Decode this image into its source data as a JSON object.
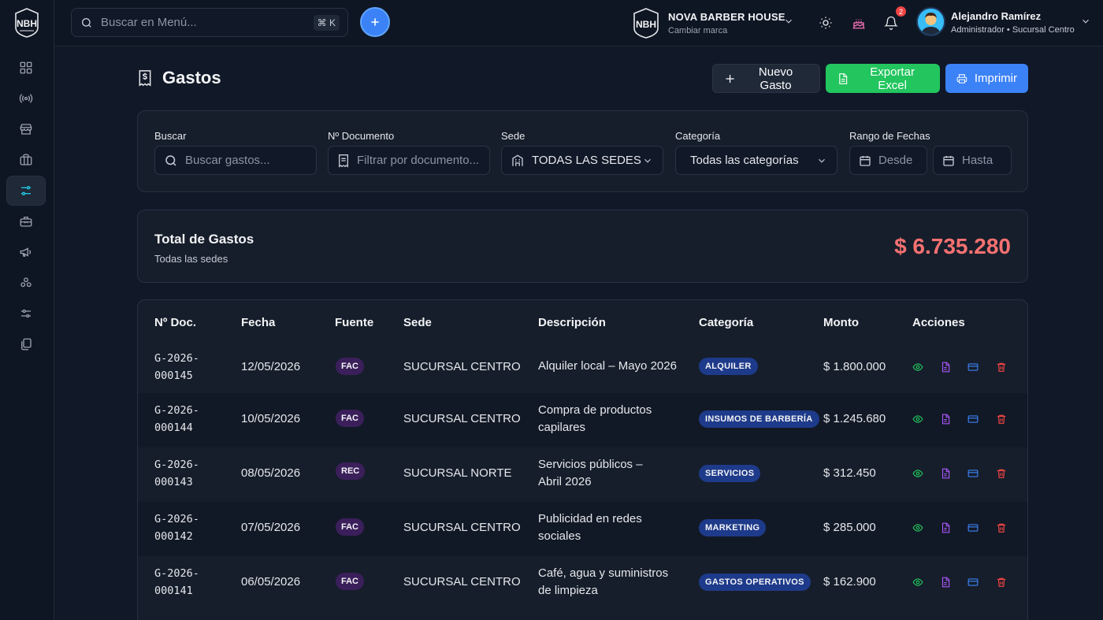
{
  "brand": {
    "logo_text": "NBH",
    "name": "NOVA BARBER HOUSE",
    "switch_label": "Cambiar marca"
  },
  "search_menu": {
    "placeholder": "Buscar en Menú...",
    "shortcut": "⌘ K"
  },
  "notifications": {
    "count": "2"
  },
  "user": {
    "name": "Alejandro Ramírez",
    "role": "Administrador • Sucursal Centro"
  },
  "sidebar": {
    "items": [
      {
        "icon": "dashboard-icon"
      },
      {
        "icon": "broadcast-icon"
      },
      {
        "icon": "store-icon"
      },
      {
        "icon": "briefcase-icon"
      },
      {
        "icon": "sliders-icon",
        "active": true
      },
      {
        "icon": "toolbox-icon"
      },
      {
        "icon": "megaphone-icon"
      },
      {
        "icon": "network-icon"
      },
      {
        "icon": "settings-sliders-icon"
      },
      {
        "icon": "documents-icon"
      }
    ]
  },
  "page": {
    "title": "Gastos",
    "buttons": {
      "new": "Nuevo Gasto",
      "export": "Exportar Excel",
      "print": "Imprimir"
    }
  },
  "filters": {
    "search": {
      "label": "Buscar",
      "placeholder": "Buscar gastos..."
    },
    "document": {
      "label": "Nº Documento",
      "placeholder": "Filtrar por documento..."
    },
    "sede": {
      "label": "Sede",
      "value": "TODAS LAS SEDES"
    },
    "category": {
      "label": "Categoría",
      "value": "Todas las categorías"
    },
    "date_range": {
      "label": "Rango de Fechas",
      "from": "Desde",
      "to": "Hasta"
    }
  },
  "total": {
    "label": "Total de Gastos",
    "sublabel": "Todas las sedes",
    "value": "$ 6.735.280"
  },
  "table": {
    "headers": {
      "doc": "Nº Doc.",
      "date": "Fecha",
      "source": "Fuente",
      "sede": "Sede",
      "desc": "Descripción",
      "category": "Categoría",
      "amount": "Monto",
      "actions": "Acciones"
    },
    "rows": [
      {
        "doc1": "G-2026-",
        "doc2": "000145",
        "date": "12/05/2026",
        "source": "FAC",
        "sede": "SUCURSAL CENTRO",
        "desc1": "Alquiler local – Mayo 2026",
        "desc2": "",
        "category": "ALQUILER",
        "amount": "$ 1.800.000"
      },
      {
        "doc1": "G-2026-",
        "doc2": "000144",
        "date": "10/05/2026",
        "source": "FAC",
        "sede": "SUCURSAL CENTRO",
        "desc1": "Compra de productos",
        "desc2": "capilares",
        "category": "INSUMOS DE BARBERÍA",
        "amount": "$ 1.245.680"
      },
      {
        "doc1": "G-2026-",
        "doc2": "000143",
        "date": "08/05/2026",
        "source": "REC",
        "sede": "SUCURSAL NORTE",
        "desc1": "Servicios públicos –",
        "desc2": "Abril 2026",
        "category": "SERVICIOS",
        "amount": "$ 312.450"
      },
      {
        "doc1": "G-2026-",
        "doc2": "000142",
        "date": "07/05/2026",
        "source": "FAC",
        "sede": "SUCURSAL CENTRO",
        "desc1": "Publicidad en redes",
        "desc2": "sociales",
        "category": "MARKETING",
        "amount": "$ 285.000"
      },
      {
        "doc1": "G-2026-",
        "doc2": "000141",
        "date": "06/05/2026",
        "source": "FAC",
        "sede": "SUCURSAL CENTRO",
        "desc1": "Café, agua y suministros",
        "desc2": "de limpieza",
        "category": "GASTOS OPERATIVOS",
        "amount": "$ 162.900"
      }
    ]
  },
  "colors": {
    "accent": "#3b82f6",
    "excel": "#22c55e",
    "total": "#f87171",
    "view": "#22c55e",
    "doc": "#a855f7",
    "card": "#3b82f6",
    "delete": "#ef4444"
  }
}
